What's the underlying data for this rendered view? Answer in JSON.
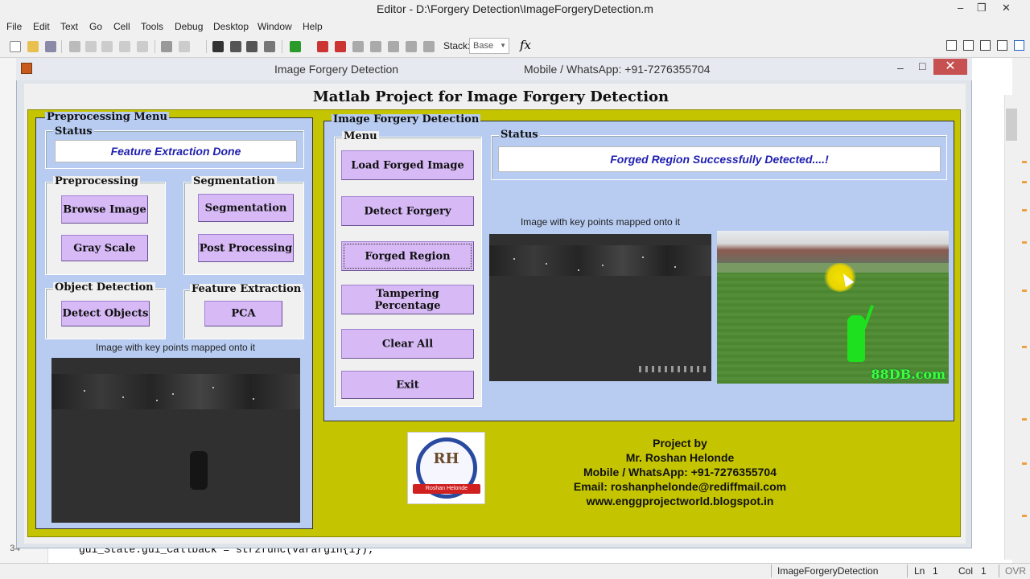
{
  "editor": {
    "title": "Editor - D:\\Forgery Detection\\ImageForgeryDetection.m",
    "window_controls": {
      "minimize": "–",
      "restore": "❐",
      "close": "✕"
    },
    "menu": [
      "File",
      "Edit",
      "Text",
      "Go",
      "Cell",
      "Tools",
      "Debug",
      "Desktop",
      "Window",
      "Help"
    ],
    "toolbar": {
      "stack_label": "Stack:",
      "stack_value": "Base",
      "fx_label": "fx"
    },
    "code_line": "gui_State.gui_Callback = str2func(varargin{1});",
    "line_number": "34",
    "status": {
      "file": "ImageForgeryDetection",
      "ln_label": "Ln",
      "ln": "1",
      "col_label": "Col",
      "col": "1",
      "ovr": "OVR"
    }
  },
  "figure": {
    "title": "Image Forgery Detection",
    "title_right": "Mobile / WhatsApp: +91-7276355704",
    "heading": "Matlab Project for Image Forgery Detection",
    "preprocessing_menu": {
      "title": "Preprocessing Menu",
      "status_title": "Status",
      "status_text": "Feature Extraction Done",
      "preprocessing": {
        "title": "Preprocessing",
        "browse": "Browse Image",
        "gray": "Gray Scale"
      },
      "segmentation": {
        "title": "Segmentation",
        "segmentation": "Segmentation",
        "post": "Post Processing"
      },
      "object_detection": {
        "title": "Object Detection",
        "detect": "Detect Objects"
      },
      "feature_extraction": {
        "title": "Feature Extraction",
        "pca": "PCA"
      },
      "image_caption": "Image with key points mapped onto it"
    },
    "forgery_panel": {
      "title": "Image Forgery Detection",
      "menu_title": "Menu",
      "buttons": {
        "load": "Load Forged Image",
        "detect": "Detect Forgery",
        "region": "Forged Region",
        "tamper": "Tampering Percentage",
        "clear": "Clear All",
        "exit": "Exit"
      },
      "status_title": "Status",
      "status_text": "Forged Region Successfully Detected....!",
      "image_caption": "Image with key points mapped onto it",
      "watermark": "88DB.com"
    },
    "credits": {
      "line1": "Project by",
      "line2": "Mr. Roshan Helonde",
      "line3": "Mobile / WhatsApp: +91-7276355704",
      "line4": "Email: roshanphelonde@rediffmail.com",
      "line5": "www.enggprojectworld.blogspot.in"
    },
    "logo": {
      "monogram": "RH",
      "arc_text": "Roshan Helonde"
    }
  },
  "colors": {
    "olive_panel": "#c4c400",
    "blue_panel": "#b8ccf2",
    "button": "#d6b9f5",
    "status_text": "#1f1fb0",
    "close_red": "#c75050"
  }
}
